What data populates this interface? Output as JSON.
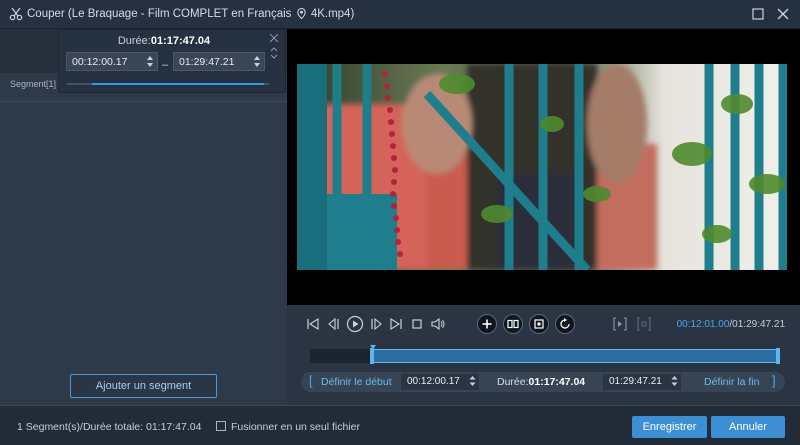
{
  "window": {
    "title": "Couper (Le Braquage - Film COMPLET en Français",
    "title_file": "4K.mp4)",
    "icons": [
      "scissors-icon",
      "location-pin-icon",
      "maximize-icon",
      "close-icon"
    ]
  },
  "left_panel": {
    "segment_label": "Segment[1]",
    "add_segment_button": "Ajouter un segment"
  },
  "popover": {
    "duration_label": "Durée:",
    "duration_value": "01:17:47.04",
    "start_value": "00:12:00.17",
    "dash": "–",
    "end_value": "01:29:47.21",
    "slider_start_fraction": 0.134,
    "slider_end_fraction": 1.0
  },
  "playback": {
    "current_time": "00:12:01.00",
    "separator": "/",
    "total_time": "01:29:47.21",
    "icons": [
      "skip-start-icon",
      "step-back-icon",
      "play-icon",
      "step-forward-icon",
      "skip-end-icon",
      "stop-icon",
      "volume-icon",
      "add-icon",
      "split-icon",
      "crop-icon",
      "rotate-icon",
      "set-start-marker-icon",
      "set-end-marker-icon"
    ]
  },
  "timeline": {
    "selection_start_fraction": 0.134,
    "selection_end_fraction": 1.0
  },
  "segment_bar": {
    "set_start_label": "Définir le début",
    "start_value": "00:12:00.17",
    "duration_label": "Durée:",
    "duration_value": "01:17:47.04",
    "end_value": "01:29:47.21",
    "set_end_label": "Définir la fin"
  },
  "footer": {
    "summary": "1 Segment(s)/Durée totale: 01:17:47.04",
    "merge_label": "Fusionner en un seul fichier",
    "merge_checked": false,
    "save_button": "Enregistrer",
    "cancel_button": "Annuler"
  },
  "colors": {
    "accent": "#2f9de6",
    "primary_button": "#3d8fd4",
    "background": "#2a3442"
  }
}
